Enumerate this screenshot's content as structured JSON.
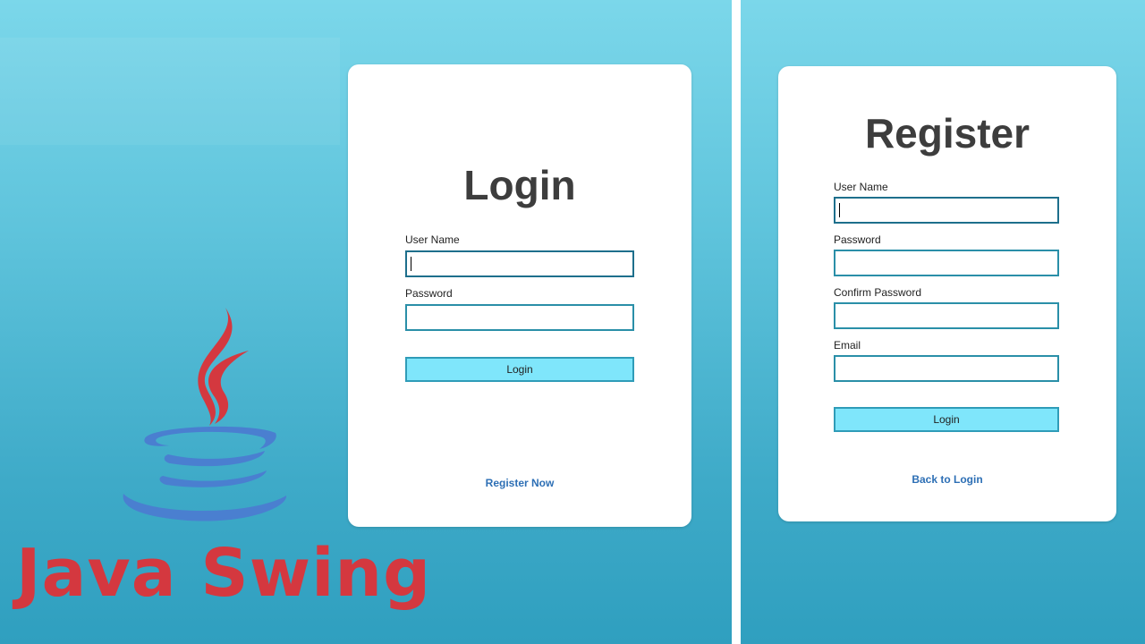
{
  "brand": {
    "title": "Java Swing",
    "logo_icon": "java-coffee-cup-icon"
  },
  "login": {
    "title": "Login",
    "username_label": "User Name",
    "username_value": "",
    "password_label": "Password",
    "password_value": "",
    "submit_label": "Login",
    "link_label": "Register Now"
  },
  "register": {
    "title": "Register",
    "username_label": "User Name",
    "username_value": "",
    "password_label": "Password",
    "password_value": "",
    "confirm_label": "Confirm Password",
    "confirm_value": "",
    "email_label": "Email",
    "email_value": "",
    "submit_label": "Login",
    "link_label": "Back to Login"
  },
  "colors": {
    "background_top": "#7bd7ea",
    "background_bottom": "#2f9fbf",
    "button_fill": "#7fe6fb",
    "input_border": "#2a8fa8",
    "link": "#2d6fb5",
    "brand_red": "#d4383f",
    "logo_blue": "#4a7fd0"
  }
}
